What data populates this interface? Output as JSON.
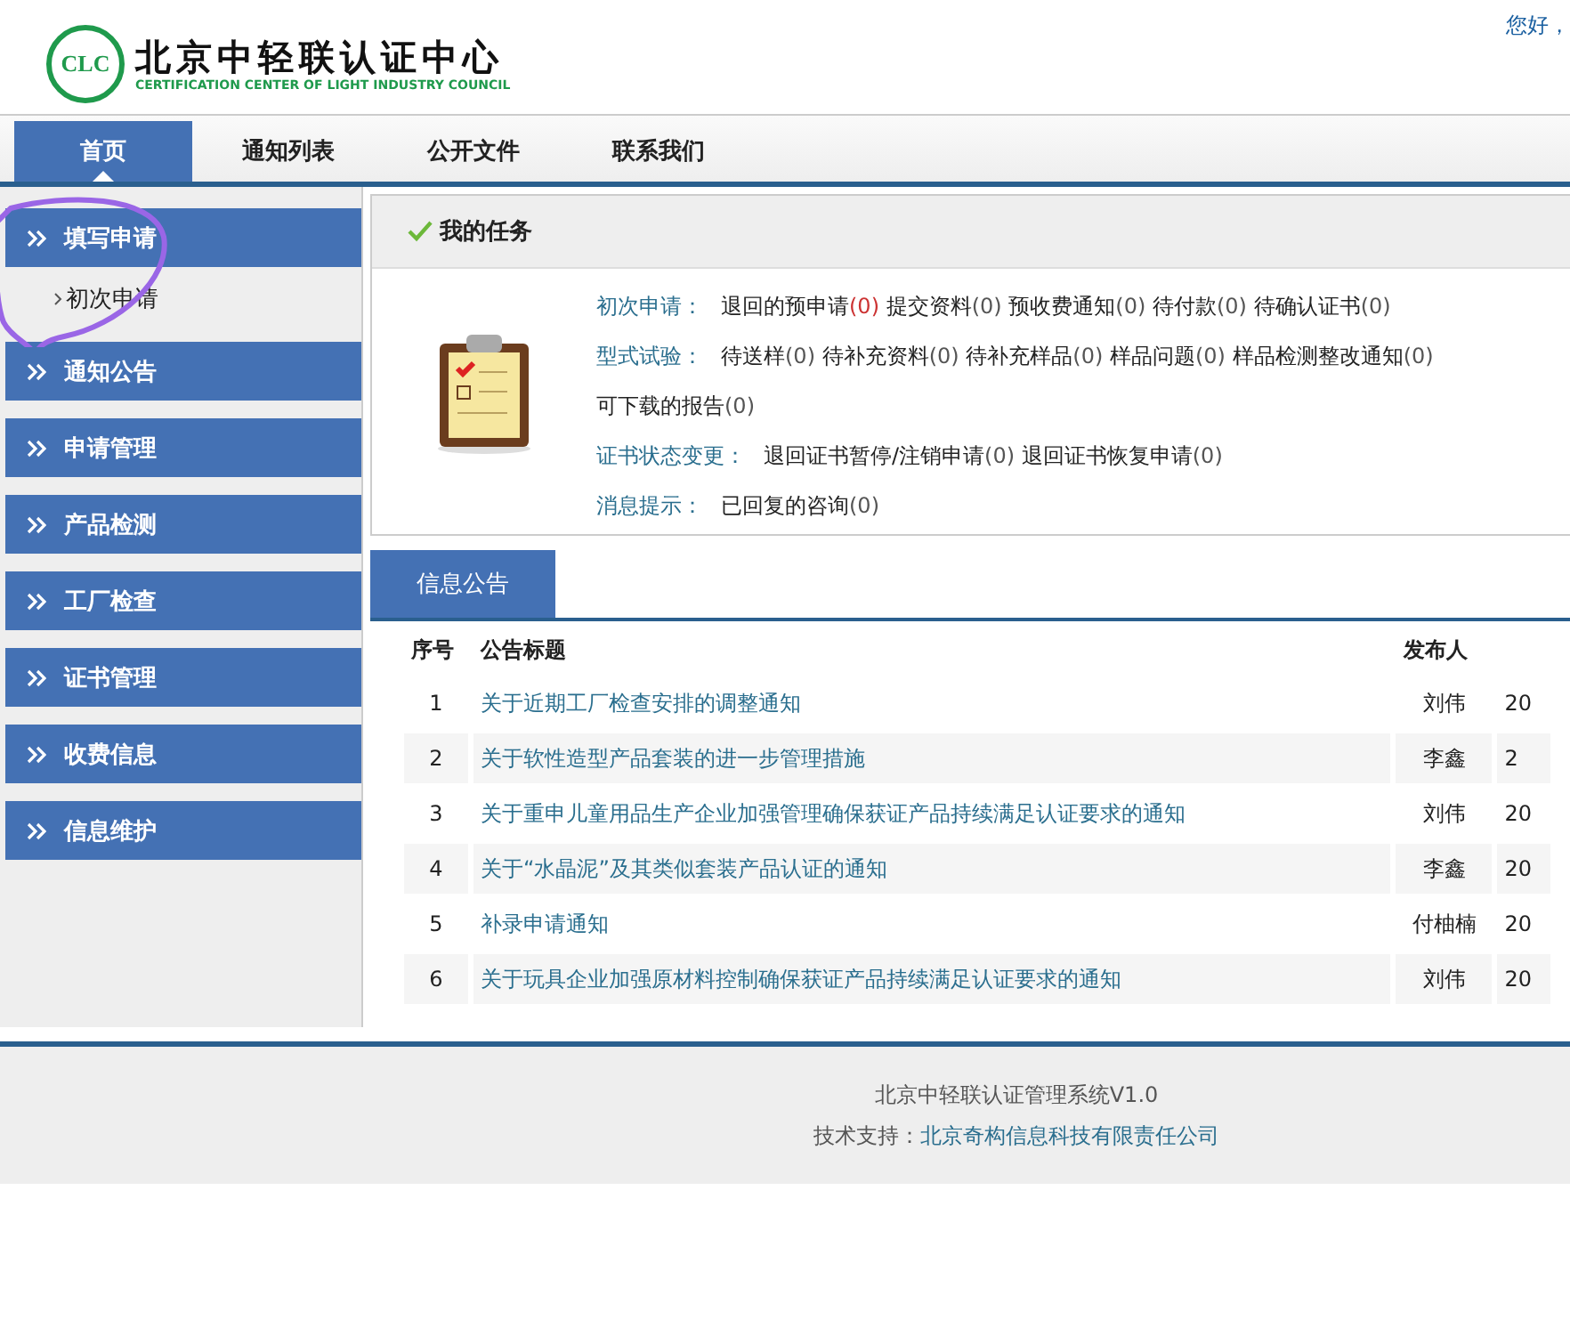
{
  "header": {
    "logo_mark": "CLC",
    "logo_cn": "北京中轻联认证中心",
    "logo_en": "CERTIFICATION CENTER OF LIGHT INDUSTRY COUNCIL",
    "greeting": "您好，"
  },
  "nav": [
    {
      "label": "首页",
      "selected": true
    },
    {
      "label": "通知列表",
      "selected": false
    },
    {
      "label": "公开文件",
      "selected": false
    },
    {
      "label": "联系我们",
      "selected": false
    }
  ],
  "sidebar": [
    {
      "label": "填写申请",
      "children": [
        {
          "label": "初次申请"
        }
      ]
    },
    {
      "label": "通知公告"
    },
    {
      "label": "申请管理"
    },
    {
      "label": "产品检测"
    },
    {
      "label": "工厂检查"
    },
    {
      "label": "证书管理"
    },
    {
      "label": "收费信息"
    },
    {
      "label": "信息维护"
    }
  ],
  "tasks": {
    "title": "我的任务",
    "groups": [
      {
        "label": "初次申请：",
        "items": [
          {
            "text": "退回的预申请",
            "count": "(0)",
            "alert": true
          },
          {
            "text": "提交资料",
            "count": "(0)",
            "alert": false
          },
          {
            "text": "预收费通知",
            "count": "(0)",
            "alert": false
          },
          {
            "text": "待付款",
            "count": "(0)",
            "alert": false
          },
          {
            "text": "待确认证书",
            "count": "(0)",
            "alert": false
          }
        ]
      },
      {
        "label": "型式试验：",
        "items": [
          {
            "text": "待送样",
            "count": "(0)",
            "alert": false
          },
          {
            "text": "待补充资料",
            "count": "(0)",
            "alert": false
          },
          {
            "text": "待补充样品",
            "count": "(0)",
            "alert": false
          },
          {
            "text": "样品问题",
            "count": "(0)",
            "alert": false
          },
          {
            "text": "样品检测整改通知",
            "count": "(0)",
            "alert": false
          },
          {
            "text": "可下载的报告",
            "count": "(0)",
            "alert": false
          }
        ]
      },
      {
        "label": "证书状态变更：",
        "items": [
          {
            "text": "退回证书暂停/注销申请",
            "count": "(0)",
            "alert": false
          },
          {
            "text": "退回证书恢复申请",
            "count": "(0)",
            "alert": false
          }
        ]
      },
      {
        "label": "消息提示：",
        "items": [
          {
            "text": "已回复的咨询",
            "count": "(0)",
            "alert": false
          }
        ]
      }
    ]
  },
  "notices": {
    "tab": "信息公告",
    "columns": [
      "序号",
      "公告标题",
      "发布人"
    ],
    "rows": [
      {
        "no": "1",
        "title": "关于近期工厂检查安排的调整通知",
        "author": "刘伟",
        "column_4": "20"
      },
      {
        "no": "2",
        "title": "关于软性造型产品套装的进一步管理措施",
        "author": "李鑫",
        "column_4": "2"
      },
      {
        "no": "3",
        "title": "关于重申儿童用品生产企业加强管理确保获证产品持续满足认证要求的通知",
        "author": "刘伟",
        "column_4": "20"
      },
      {
        "no": "4",
        "title": "关于“水晶泥”及其类似套装产品认证的通知",
        "author": "李鑫",
        "column_4": "20"
      },
      {
        "no": "5",
        "title": "补录申请通知",
        "author": "付柚楠",
        "column_4": "20"
      },
      {
        "no": "6",
        "title": "关于玩具企业加强原材料控制确保获证产品持续满足认证要求的通知",
        "author": "刘伟",
        "column_4": "20"
      }
    ]
  },
  "footer": {
    "system": "北京中轻联认证管理系统V1.0",
    "support_label": "技术支持：",
    "support_link": "北京奇构信息科技有限责任公司"
  }
}
